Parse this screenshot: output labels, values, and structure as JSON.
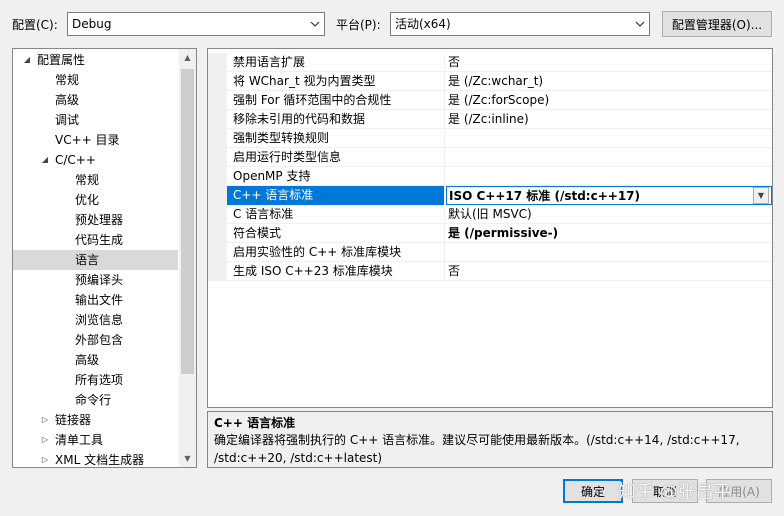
{
  "header": {
    "config_label": "配置(C):",
    "config_value": "Debug",
    "platform_label": "平台(P):",
    "platform_value": "活动(x64)",
    "config_manager_button": "配置管理器(O)..."
  },
  "tree": {
    "items": [
      {
        "label": "配置属性",
        "level": 0,
        "expander": "expanded"
      },
      {
        "label": "常规",
        "level": 1
      },
      {
        "label": "高级",
        "level": 1
      },
      {
        "label": "调试",
        "level": 1
      },
      {
        "label": "VC++ 目录",
        "level": 1
      },
      {
        "label": "C/C++",
        "level": 1,
        "expander": "expanded"
      },
      {
        "label": "常规",
        "level": 2
      },
      {
        "label": "优化",
        "level": 2
      },
      {
        "label": "预处理器",
        "level": 2
      },
      {
        "label": "代码生成",
        "level": 2
      },
      {
        "label": "语言",
        "level": 2,
        "selected": true
      },
      {
        "label": "预编译头",
        "level": 2
      },
      {
        "label": "输出文件",
        "level": 2
      },
      {
        "label": "浏览信息",
        "level": 2
      },
      {
        "label": "外部包含",
        "level": 2
      },
      {
        "label": "高级",
        "level": 2
      },
      {
        "label": "所有选项",
        "level": 2
      },
      {
        "label": "命令行",
        "level": 2
      },
      {
        "label": "链接器",
        "level": 1,
        "expander": "collapsed"
      },
      {
        "label": "清单工具",
        "level": 1,
        "expander": "collapsed"
      },
      {
        "label": "XML 文档生成器",
        "level": 1,
        "expander": "collapsed"
      }
    ]
  },
  "grid": {
    "rows": [
      {
        "name": "禁用语言扩展",
        "value": "否"
      },
      {
        "name": "将 WChar_t 视为内置类型",
        "value": "是 (/Zc:wchar_t)"
      },
      {
        "name": "强制 For 循环范围中的合规性",
        "value": "是 (/Zc:forScope)"
      },
      {
        "name": "移除未引用的代码和数据",
        "value": "是 (/Zc:inline)"
      },
      {
        "name": "强制类型转换规则",
        "value": ""
      },
      {
        "name": "启用运行时类型信息",
        "value": ""
      },
      {
        "name": "OpenMP 支持",
        "value": ""
      },
      {
        "name": "C++ 语言标准",
        "value": "ISO C++17 标准 (/std:c++17)",
        "bold": true,
        "selected": true
      },
      {
        "name": "C 语言标准",
        "value": "默认(旧 MSVC)"
      },
      {
        "name": "符合模式",
        "value": "是 (/permissive-)",
        "bold": true
      },
      {
        "name": "启用实验性的 C++ 标准库模块",
        "value": ""
      },
      {
        "name": "生成 ISO C++23 标准库模块",
        "value": "否"
      }
    ]
  },
  "description": {
    "title": "C++ 语言标准",
    "text": "确定编译器将强制执行的 C++ 语言标准。建议尽可能使用最新版本。(/std:c++14, /std:c++17, /std:c++20, /std:c++latest)"
  },
  "footer": {
    "ok_button": "确定",
    "cancel_button": "取消",
    "apply_button": "应用(A)"
  },
  "watermark": "知乎 @张昌平",
  "colors": {
    "selection_blue": "#0078d7",
    "tree_selected": "#d9d9d9",
    "dialog_bg": "#f0f0f0"
  }
}
